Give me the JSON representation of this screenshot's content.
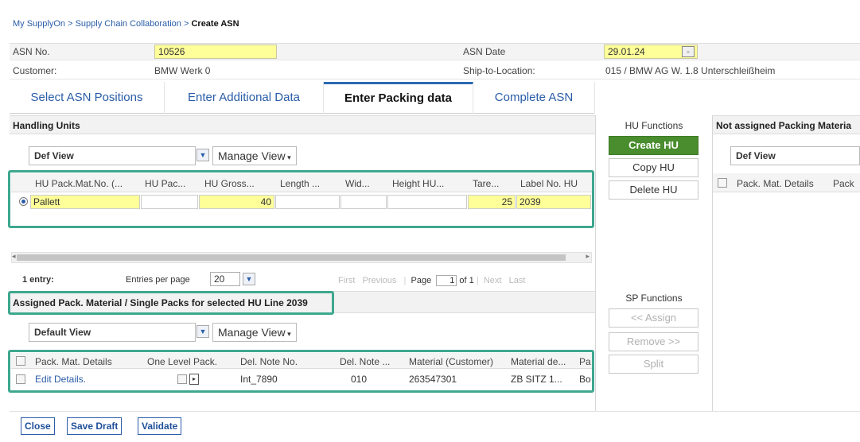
{
  "breadcrumb": {
    "part1": "My SupplyOn",
    "sep1": ">",
    "part2": "Supply Chain Collaboration",
    "sep2": ">",
    "current": "Create ASN"
  },
  "header": {
    "asn_no_label": "ASN No.",
    "asn_no_value": "10526",
    "asn_date_label": "ASN Date",
    "asn_date_value": "29.01.24",
    "customer_label": "Customer:",
    "customer_value": "BMW Werk 0",
    "ship_to_label": "Ship-to-Location:",
    "ship_to_value": "015 / BMW AG W. 1.8 Unterschleißheim"
  },
  "tabs": [
    {
      "label": "Select ASN Positions"
    },
    {
      "label": "Enter Additional Data"
    },
    {
      "label": "Enter Packing data"
    },
    {
      "label": "Complete ASN"
    }
  ],
  "handling_units": {
    "title": "Handling Units",
    "view_select": "Def View",
    "manage_view": "Manage View",
    "columns": [
      "HU Pack.Mat.No. (...",
      "HU Pac...",
      "HU Gross...",
      "Length ...",
      "Wid...",
      "Height HU...",
      "Tare...",
      "Label No. HU"
    ],
    "row": {
      "pack_mat": "Pallett",
      "hu_pac": "",
      "gross": "40",
      "length": "",
      "width": "",
      "height": "",
      "tare": "25",
      "label_no": "2039"
    },
    "entries": "1 entry:",
    "entries_per_page_label": "Entries per page",
    "entries_per_page": "20",
    "pager_first": "First",
    "pager_previous": "Previous",
    "pager_page_label": "Page",
    "pager_page": "1",
    "pager_of": "of 1",
    "pager_next": "Next",
    "pager_last": "Last"
  },
  "hu_functions": {
    "title": "HU Functions",
    "create": "Create HU",
    "copy": "Copy HU",
    "delete": "Delete HU"
  },
  "sp_functions": {
    "title": "SP Functions",
    "assign": "<< Assign",
    "remove": "Remove >>",
    "split": "Split"
  },
  "not_assigned": {
    "title": "Not assigned Packing Materia",
    "view_select": "Def View",
    "col1": "Pack. Mat. Details",
    "col2": "Pack"
  },
  "assigned": {
    "title": "Assigned Pack. Material / Single Packs for selected HU Line 2039",
    "view_select": "Default View",
    "manage_view": "Manage View",
    "columns": [
      "Pack. Mat. Details",
      "One Level Pack.",
      "Del. Note No.",
      "Del. Note ...",
      "Material (Customer)",
      "Material de...",
      "Pa"
    ],
    "row": {
      "details": "Edit Details.",
      "del_note_no": "Int_7890",
      "del_note_item": "010",
      "material_customer": "263547301",
      "material_desc": "ZB SITZ 1...",
      "pa": "Bo"
    }
  },
  "footer": {
    "close": "Close",
    "save_draft": "Save Draft",
    "validate": "Validate"
  }
}
